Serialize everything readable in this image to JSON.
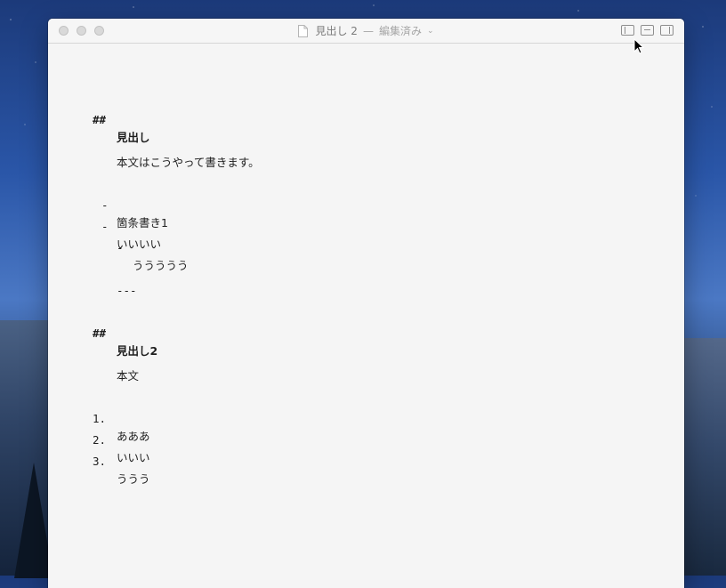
{
  "window": {
    "title": "見出し 2",
    "separator": "—",
    "status": "編集済み",
    "chevron": "⌄",
    "icons": {
      "document": "document-icon",
      "sidebar_left": "sidebar-left-icon",
      "layout_split": "layout-icon",
      "sidebar_right": "sidebar-right-icon"
    }
  },
  "editor": {
    "heading1": {
      "marker": "##",
      "text": "見出し"
    },
    "body1": "本文はこうやって書きます。",
    "bullets": [
      {
        "marker": "-",
        "text": "箇条書き1"
      },
      {
        "marker": "-",
        "text": "いいいい"
      }
    ],
    "sub_bullet": {
      "marker": "-",
      "text": "ううううう"
    },
    "rule": "---",
    "heading2": {
      "marker": "##",
      "text": "見出し2"
    },
    "body2": "本文",
    "numbered": [
      {
        "marker": "1.",
        "text": "あああ"
      },
      {
        "marker": "2.",
        "text": "いいい"
      },
      {
        "marker": "3.",
        "text": "ううう"
      }
    ]
  },
  "colors": {
    "editor_bg": "#f5f5f5",
    "text": "#1e1e1e",
    "title_text": "#8a8a8a"
  }
}
